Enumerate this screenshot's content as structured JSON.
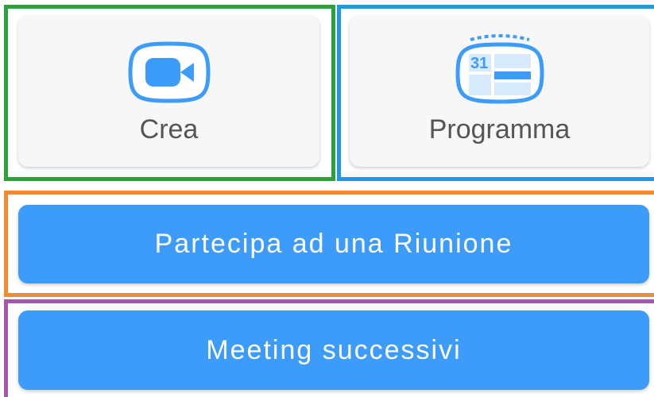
{
  "actions": {
    "create": {
      "label": "Crea",
      "icon": "video-camera-icon"
    },
    "schedule": {
      "label": "Programma",
      "icon": "calendar-icon",
      "calendar_day": "31"
    },
    "join_label": "Partecipa ad una Riunione",
    "upcoming_label": "Meeting successivi"
  },
  "colors": {
    "accent_blue": "#3d9cfa",
    "highlight_green": "#29a339",
    "highlight_blue": "#1e9be0",
    "highlight_orange": "#f58a32",
    "highlight_purple": "#a556ae"
  }
}
